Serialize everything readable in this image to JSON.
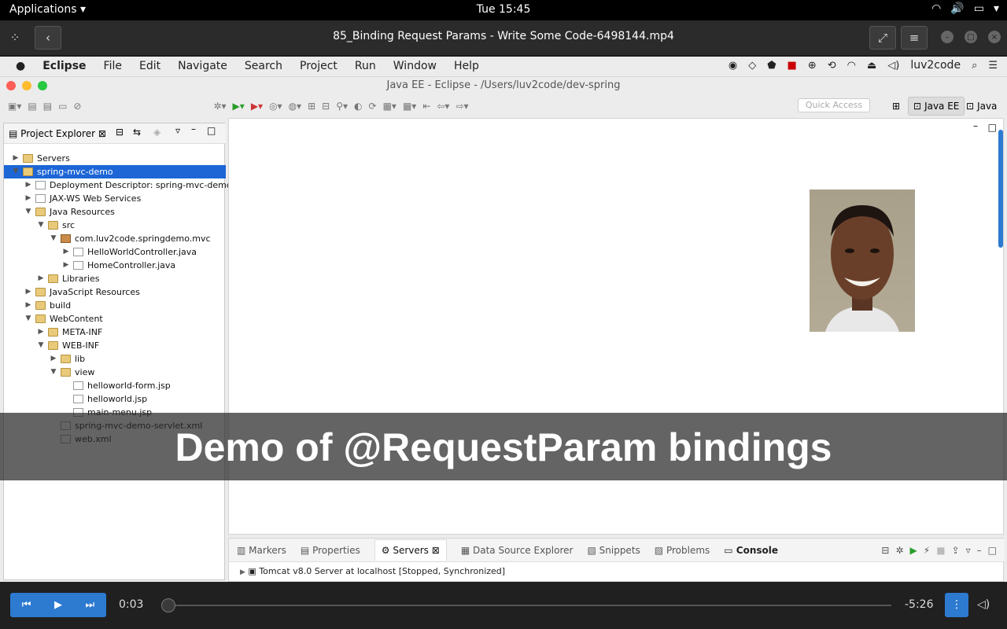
{
  "system_bar": {
    "apps_label": "Applications",
    "clock": "Tue 15:45"
  },
  "video_window": {
    "title": "85_Binding Request Params - Write Some Code-6498144.mp4"
  },
  "mac_menu": {
    "items": [
      "Eclipse",
      "File",
      "Edit",
      "Navigate",
      "Search",
      "Project",
      "Run",
      "Window",
      "Help"
    ],
    "user": "luv2code"
  },
  "eclipse": {
    "window_title": "Java EE - Eclipse - /Users/luv2code/dev-spring",
    "quick_access": "Quick Access",
    "perspective_javaee": "Java EE",
    "perspective_java": "Java"
  },
  "explorer": {
    "tab_label": "Project Explorer",
    "tree": [
      {
        "label": "Servers",
        "depth": 0,
        "twisty": "▶",
        "icon": "folder"
      },
      {
        "label": "spring-mvc-demo",
        "depth": 0,
        "twisty": "▼",
        "icon": "project",
        "selected": true
      },
      {
        "label": "Deployment Descriptor: spring-mvc-demo",
        "depth": 1,
        "twisty": "▶",
        "icon": "descriptor"
      },
      {
        "label": "JAX-WS Web Services",
        "depth": 1,
        "twisty": "▶",
        "icon": "webservice"
      },
      {
        "label": "Java Resources",
        "depth": 1,
        "twisty": "▼",
        "icon": "resources"
      },
      {
        "label": "src",
        "depth": 2,
        "twisty": "▼",
        "icon": "folder"
      },
      {
        "label": "com.luv2code.springdemo.mvc",
        "depth": 3,
        "twisty": "▼",
        "icon": "package"
      },
      {
        "label": "HelloWorldController.java",
        "depth": 4,
        "twisty": "▶",
        "icon": "java-file"
      },
      {
        "label": "HomeController.java",
        "depth": 4,
        "twisty": "▶",
        "icon": "java-file"
      },
      {
        "label": "Libraries",
        "depth": 2,
        "twisty": "▶",
        "icon": "library"
      },
      {
        "label": "JavaScript Resources",
        "depth": 1,
        "twisty": "▶",
        "icon": "resources"
      },
      {
        "label": "build",
        "depth": 1,
        "twisty": "▶",
        "icon": "folder"
      },
      {
        "label": "WebContent",
        "depth": 1,
        "twisty": "▼",
        "icon": "folder"
      },
      {
        "label": "META-INF",
        "depth": 2,
        "twisty": "▶",
        "icon": "folder"
      },
      {
        "label": "WEB-INF",
        "depth": 2,
        "twisty": "▼",
        "icon": "folder"
      },
      {
        "label": "lib",
        "depth": 3,
        "twisty": "▶",
        "icon": "folder"
      },
      {
        "label": "view",
        "depth": 3,
        "twisty": "▼",
        "icon": "folder"
      },
      {
        "label": "helloworld-form.jsp",
        "depth": 4,
        "twisty": "",
        "icon": "file"
      },
      {
        "label": "helloworld.jsp",
        "depth": 4,
        "twisty": "",
        "icon": "file"
      },
      {
        "label": "main-menu.jsp",
        "depth": 4,
        "twisty": "",
        "icon": "file"
      },
      {
        "label": "spring-mvc-demo-servlet.xml",
        "depth": 3,
        "twisty": "",
        "icon": "xml-file"
      },
      {
        "label": "web.xml",
        "depth": 3,
        "twisty": "",
        "icon": "xml-file"
      }
    ]
  },
  "servers_panel": {
    "tabs": [
      "Markers",
      "Properties",
      "Servers",
      "Data Source Explorer",
      "Snippets",
      "Problems",
      "Console"
    ],
    "active_tab": "Servers",
    "server_row": "Tomcat v8.0 Server at localhost  [Stopped, Synchronized]"
  },
  "caption": "Demo of @RequestParam bindings",
  "player": {
    "elapsed": "0:03",
    "remaining": "-5:26",
    "progress": 0.01
  }
}
